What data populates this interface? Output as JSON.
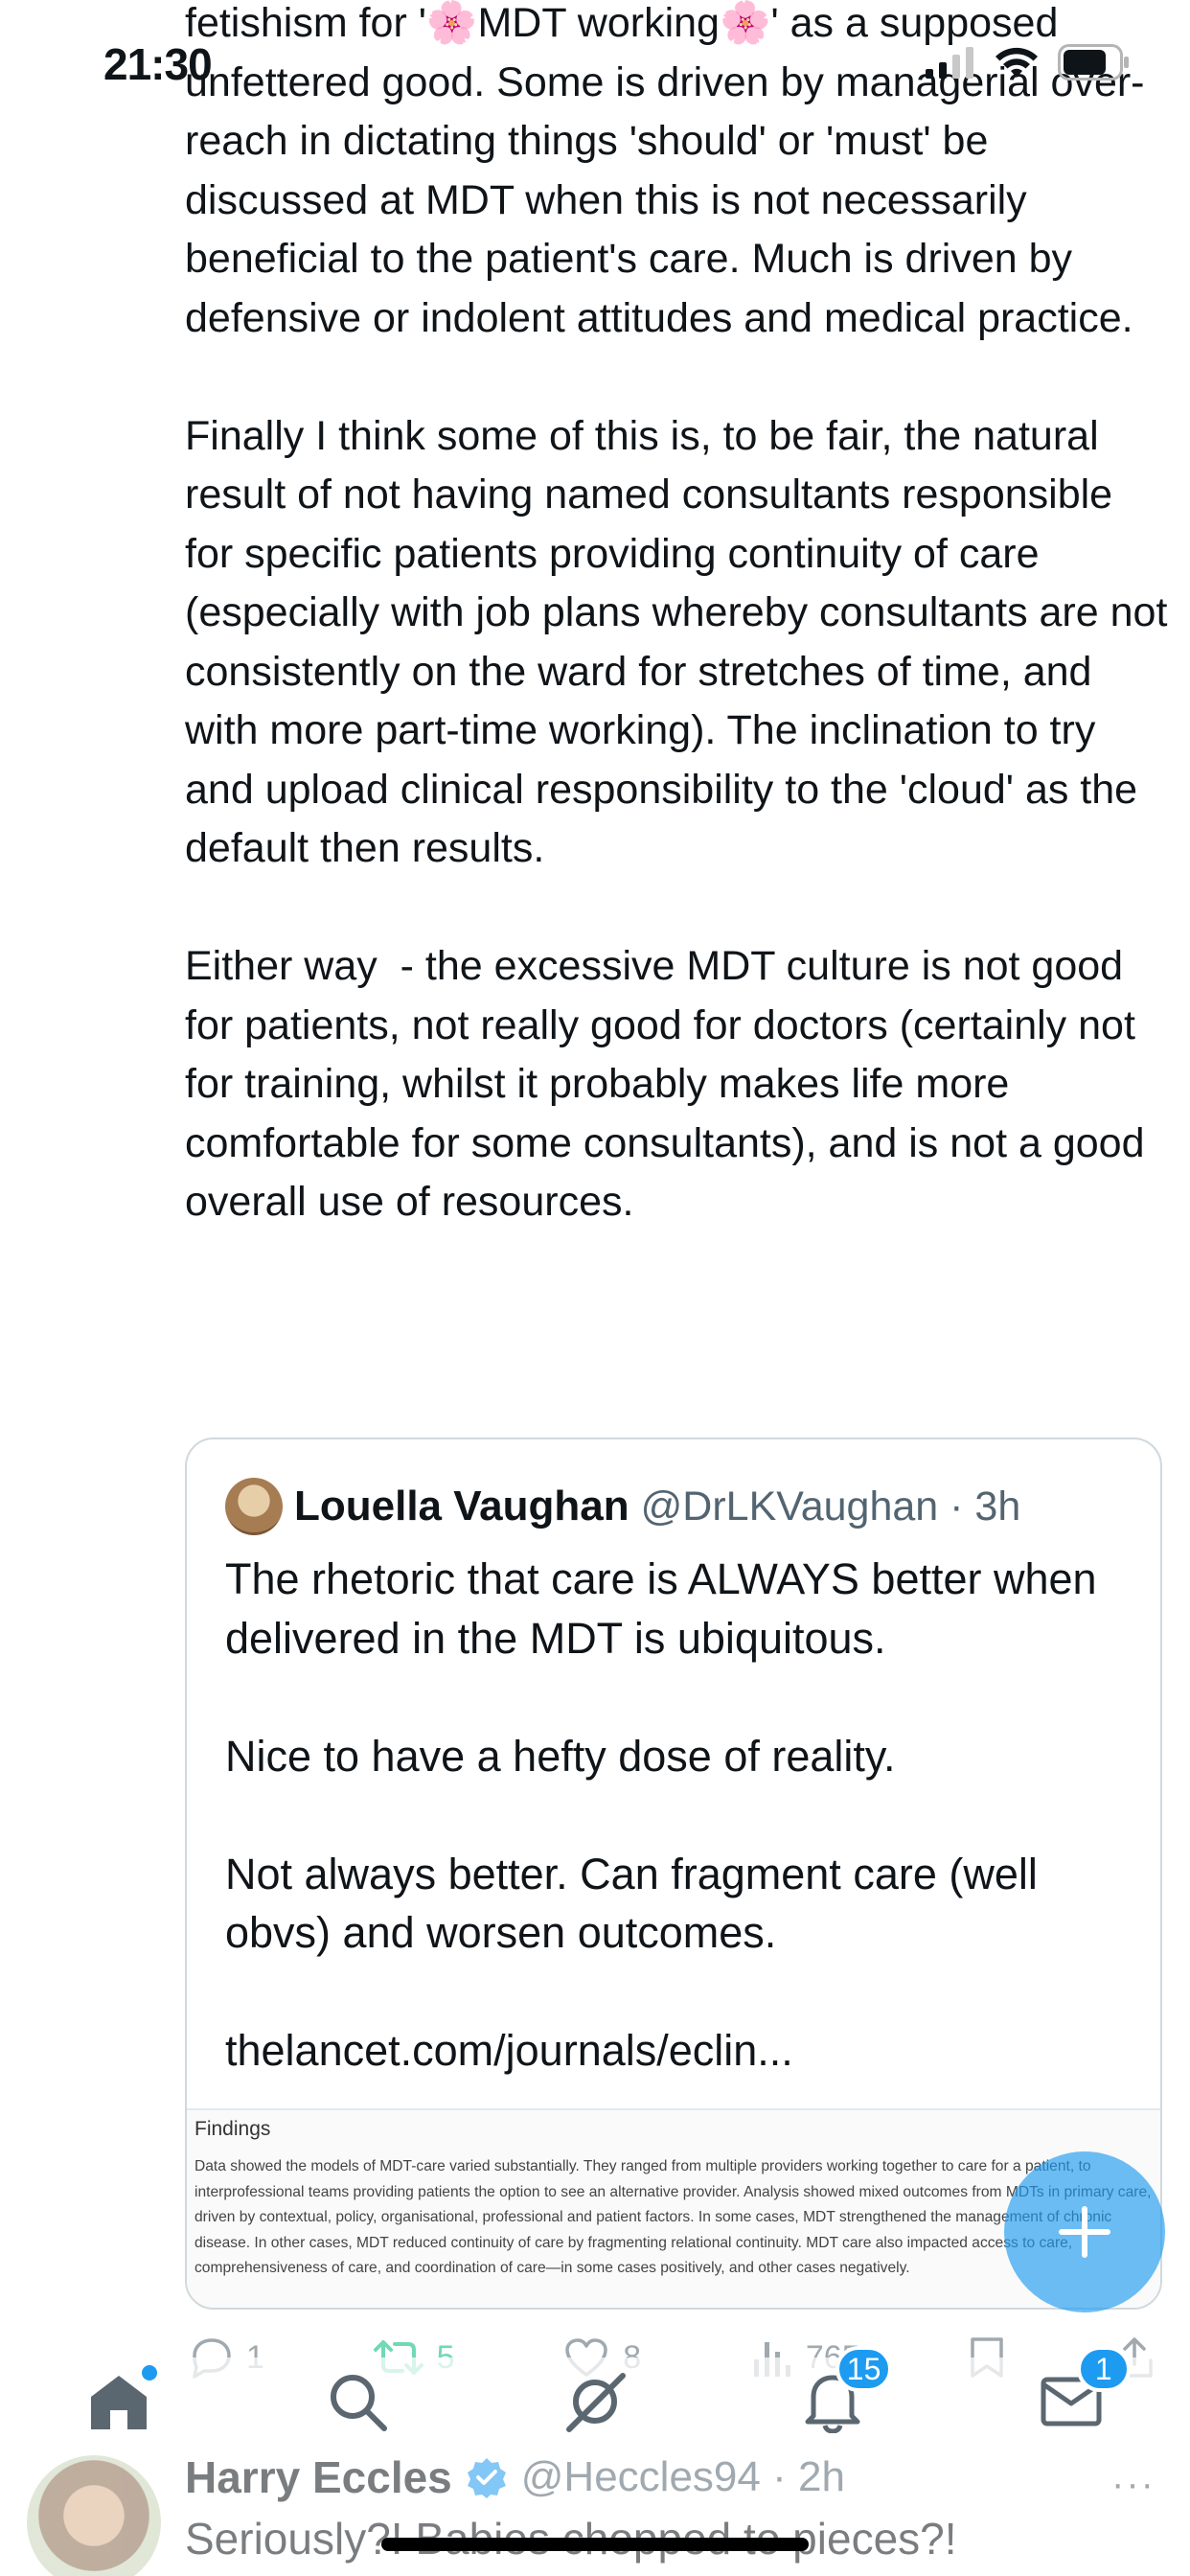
{
  "status_bar": {
    "time": "21:30"
  },
  "tweet": {
    "paragraphs": [
      "fetishism for '🌸MDT working🌸' as a supposed unfettered good. Some is driven by managerial over-reach in dictating things 'should' or 'must' be discussed at MDT when this is not necessarily beneficial to the patient's care. Much is driven by defensive or indolent attitudes and medical practice.",
      "Finally I think some of this is, to be fair, the natural result of not having named consultants responsible for specific patients providing continuity of care (especially with job plans whereby consultants are not consistently on the ward for stretches of time, and with more part-time working). The inclination to try and upload clinical responsibility to the 'cloud' as the default then results.",
      "Either way  - the excessive MDT culture is not good for patients, not really good for doctors (certainly not for training, whilst it probably makes life more comfortable for some consultants), and is not a good overall use of resources."
    ]
  },
  "quote": {
    "name": "Louella Vaughan",
    "handle": "@DrLKVaughan · 3h",
    "paragraphs": [
      "The rhetoric that care is ALWAYS better when delivered in the MDT is ubiquitous.",
      "Nice to have a hefty dose of reality.",
      "Not always better. Can fragment care (well obvs) and worsen outcomes.",
      "thelancet.com/journals/eclin..."
    ],
    "findings_title": "Findings",
    "findings_text": "Data showed the models of MDT-care varied substantially. They ranged from multiple providers working together to care for a patient, to interprofessional teams providing patients the option to see an alternative provider. Analysis showed mixed outcomes from MDTs in primary care, driven by contextual, policy, organisational, professional and patient factors. In some cases, MDT strengthened the management of chronic disease. In other cases, MDT reduced continuity of care by fragmenting relational continuity. MDT care also impacted access to care, comprehensiveness of care, and coordination of care—in some cases positively, and other cases negatively."
  },
  "actions": {
    "replies": "1",
    "reposts": "5",
    "likes": "8",
    "views": "765"
  },
  "tabbar": {
    "notifications_badge": "15",
    "messages_badge": "1"
  },
  "fab": {
    "icon": "plus-icon"
  },
  "next_tweet": {
    "name": "Harry Eccles",
    "handle": "@Heccles94 · 2h",
    "text": "Seriously?! Babies chopped to pieces?!",
    "more": "···"
  },
  "colors": {
    "accent": "#1d9bf0",
    "repost": "#00ba7c",
    "text": "#0f1419",
    "muted": "#536471"
  }
}
